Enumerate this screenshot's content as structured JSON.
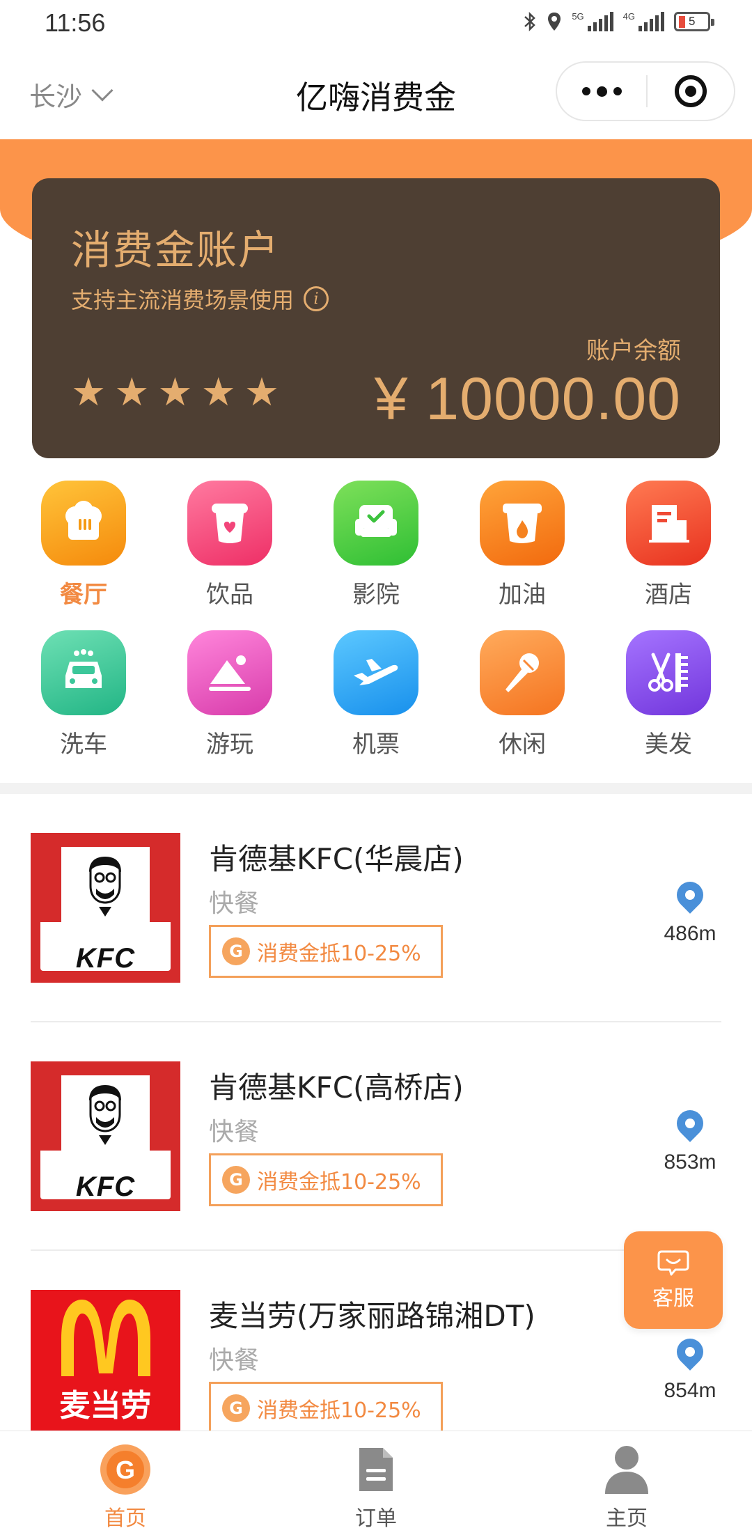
{
  "status_bar": {
    "time": "11:56",
    "battery": "5",
    "sim1": "5G",
    "sim2": "4G"
  },
  "nav": {
    "city": "长沙",
    "title": "亿嗨消费金"
  },
  "account": {
    "title": "消费金账户",
    "subtitle": "支持主流消费场景使用",
    "info_symbol": "i",
    "balance_label": "账户余额",
    "balance": "¥ 10000.00",
    "stars": 5,
    "star_glyph": "★"
  },
  "categories": [
    {
      "label": "餐厅",
      "icon": "restaurant-icon",
      "color": "#f7a21b",
      "active": true
    },
    {
      "label": "饮品",
      "icon": "drink-icon",
      "color": "#f2457a",
      "active": false
    },
    {
      "label": "影院",
      "icon": "cinema-icon",
      "color": "#4cc93f",
      "active": false
    },
    {
      "label": "加油",
      "icon": "fuel-icon",
      "color": "#f97b1a",
      "active": false
    },
    {
      "label": "酒店",
      "icon": "hotel-icon",
      "color": "#ef4a35",
      "active": false
    },
    {
      "label": "洗车",
      "icon": "car-wash-icon",
      "color": "#3cc79a",
      "active": false
    },
    {
      "label": "游玩",
      "icon": "travel-icon",
      "color": "#e954c0",
      "active": false
    },
    {
      "label": "机票",
      "icon": "flight-icon",
      "color": "#2fa9f2",
      "active": false
    },
    {
      "label": "休闲",
      "icon": "leisure-icon",
      "color": "#f98a38",
      "active": false
    },
    {
      "label": "美发",
      "icon": "hair-icon",
      "color": "#8a4ee6",
      "active": false
    }
  ],
  "stores": [
    {
      "name": "肯德基KFC(华晨店)",
      "category": "快餐",
      "tag": "消费金抵10-25%",
      "distance": "486m",
      "logo": "KFC"
    },
    {
      "name": "肯德基KFC(高桥店)",
      "category": "快餐",
      "tag": "消费金抵10-25%",
      "distance": "853m",
      "logo": "KFC"
    },
    {
      "name": "麦当劳(万家丽路锦湘DT)",
      "category": "快餐",
      "tag": "消费金抵10-25%",
      "distance": "854m",
      "logo": "麦当劳"
    }
  ],
  "coin_glyph": "G",
  "customer_service": {
    "label": "客服"
  },
  "tabs": [
    {
      "label": "首页",
      "icon": "home-coin-icon",
      "active": true
    },
    {
      "label": "订单",
      "icon": "order-icon",
      "active": false
    },
    {
      "label": "主页",
      "icon": "profile-icon",
      "active": false
    }
  ],
  "colors": {
    "accent": "#fc944a",
    "card": "#4e3f33",
    "gold": "#e4ad6f",
    "pin": "#4a90d9"
  }
}
